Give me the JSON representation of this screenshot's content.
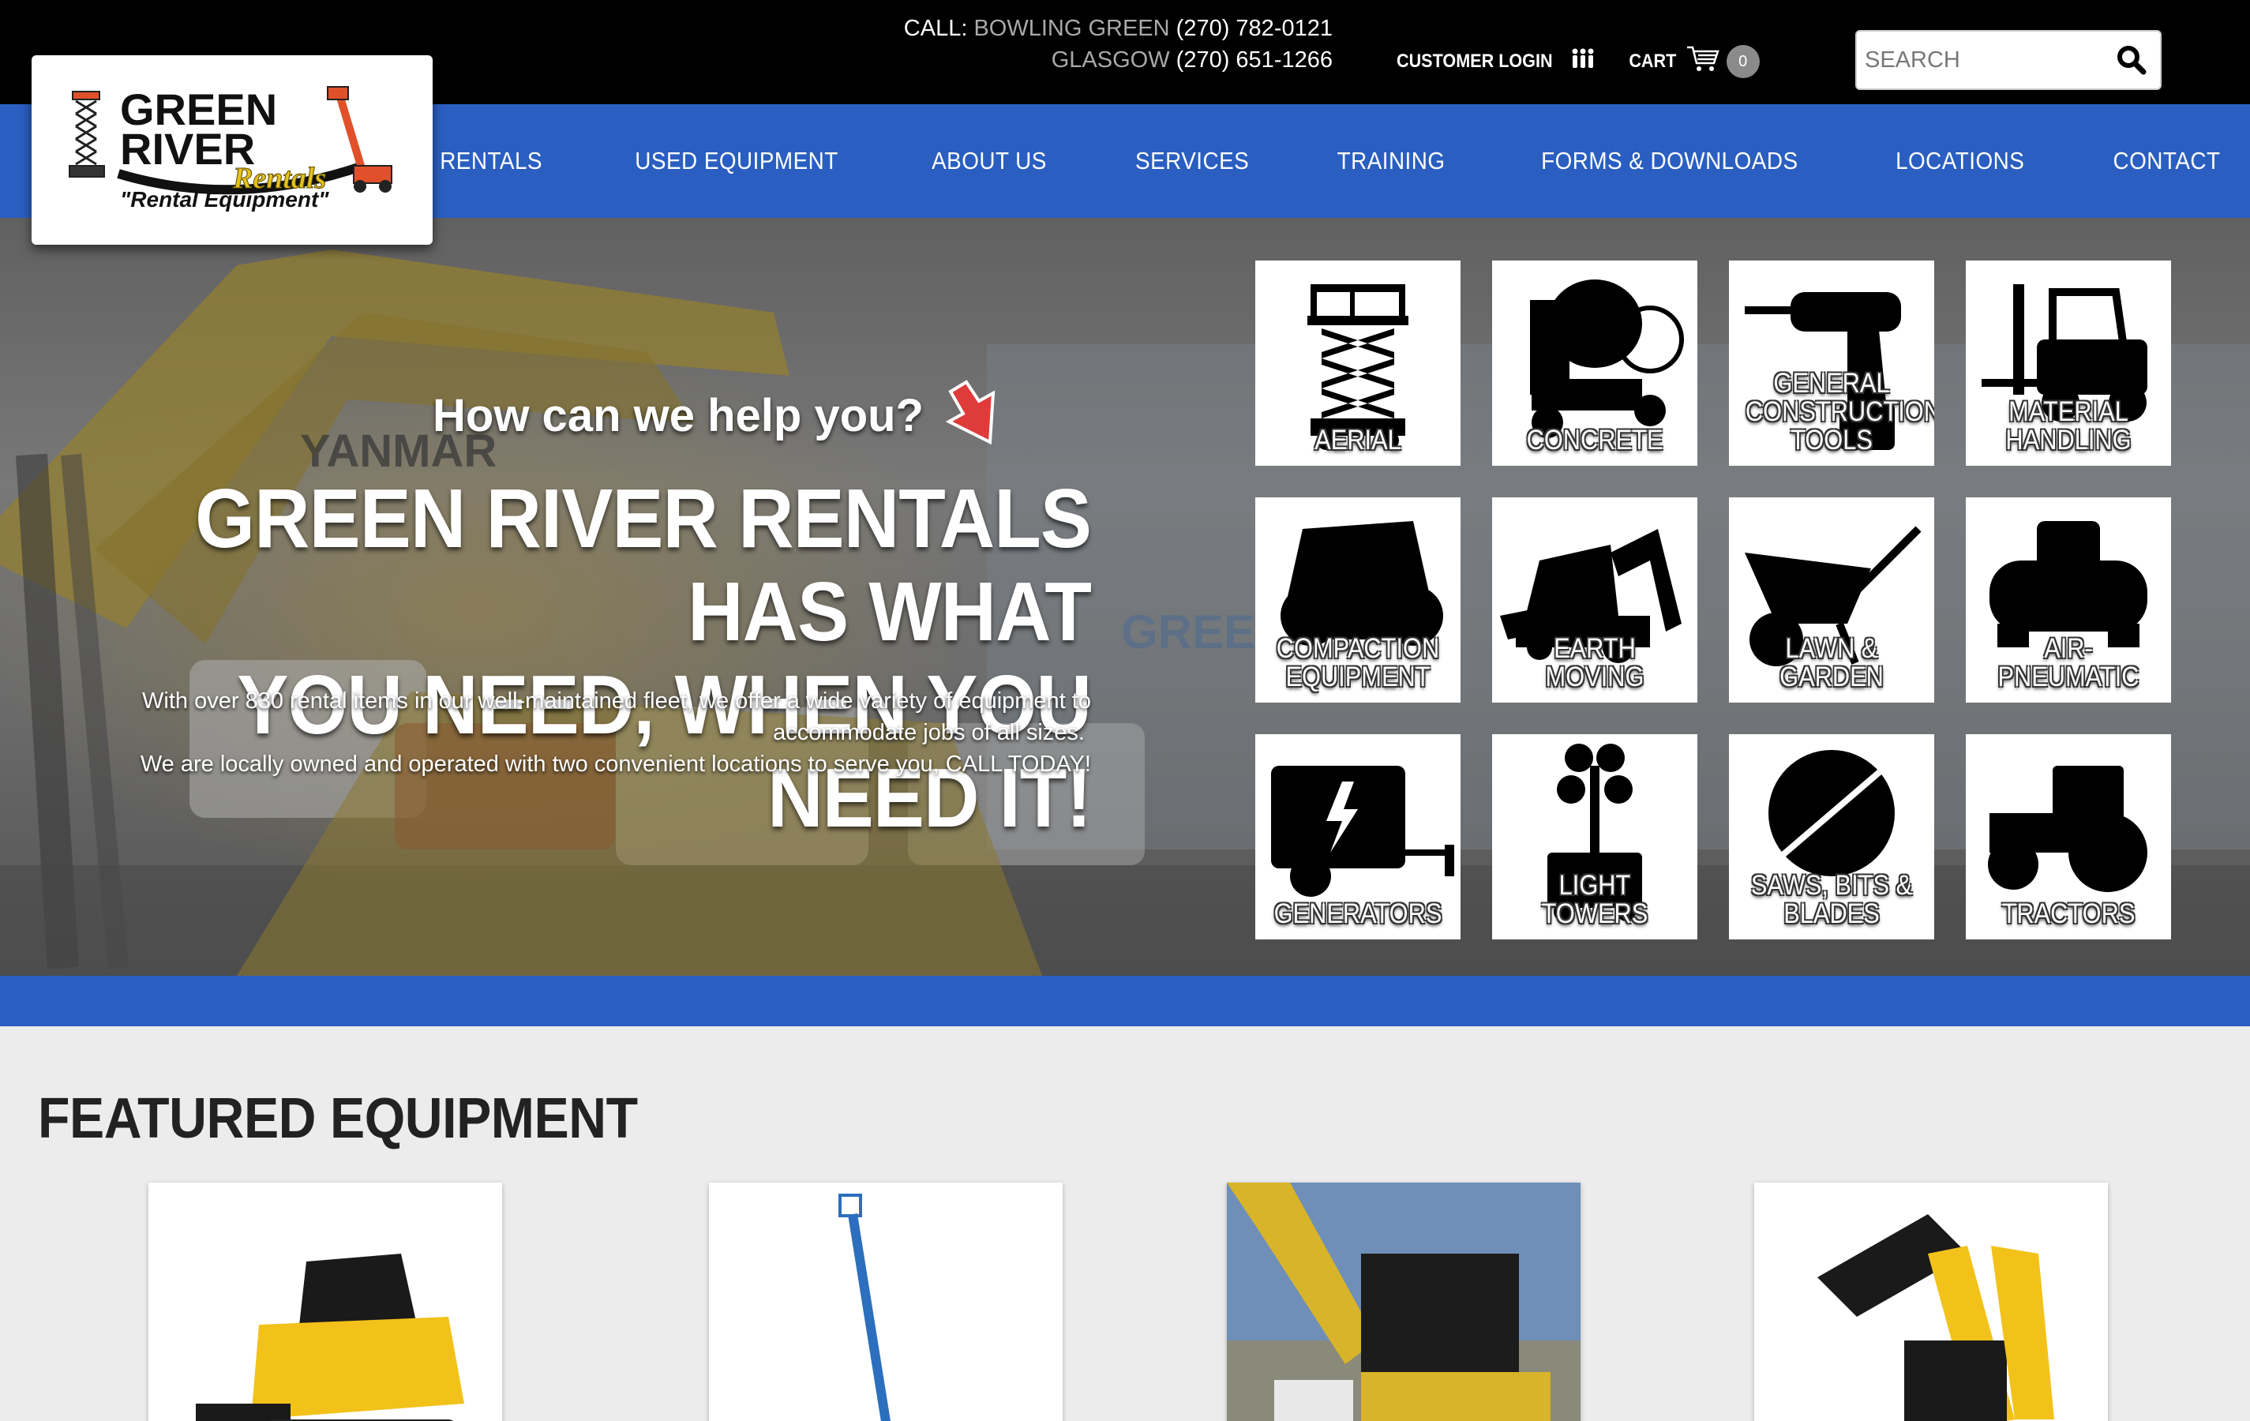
{
  "header": {
    "call_label": "CALL:",
    "phones": [
      {
        "location": "BOWLING GREEN",
        "number": "(270) 782-0121"
      },
      {
        "location": "GLASGOW",
        "number": "(270) 651-1266"
      }
    ],
    "customer_login": "CUSTOMER LOGIN",
    "cart_label": "CART",
    "cart_count": "0",
    "search_placeholder": "SEARCH"
  },
  "logo": {
    "line1": "GREEN",
    "line2": "RIVER",
    "script": "Rentals",
    "tagline": "\"Rental Equipment\""
  },
  "nav": {
    "items": [
      "RENTALS",
      "USED EQUIPMENT",
      "ABOUT US",
      "SERVICES",
      "TRAINING",
      "FORMS & DOWNLOADS",
      "LOCATIONS",
      "CONTACT"
    ]
  },
  "hero": {
    "question": "How can we help you?",
    "headline_line1": "GREEN RIVER RENTALS HAS WHAT",
    "headline_line2": "YOU NEED, WHEN YOU NEED IT!",
    "desc_line1": "With over 830 rental items in our well-maintained fleet, we offer a wide variety of equipment to",
    "desc_line2": "accommodate jobs of all sizes.",
    "desc_line3": "We are locally owned and operated with two convenient locations to serve you, CALL TODAY!",
    "categories": [
      {
        "label": "AERIAL",
        "icon": "scissor-lift-icon"
      },
      {
        "label": "CONCRETE",
        "icon": "concrete-mixer-icon"
      },
      {
        "label": "GENERAL CONSTRUCTION TOOLS",
        "icon": "drill-icon"
      },
      {
        "label": "MATERIAL HANDLING",
        "icon": "forklift-icon"
      },
      {
        "label": "COMPACTION EQUIPMENT",
        "icon": "roller-icon"
      },
      {
        "label": "EARTH MOVING",
        "icon": "backhoe-icon"
      },
      {
        "label": "LAWN & GARDEN",
        "icon": "wheelbarrow-icon"
      },
      {
        "label": "AIR-PNEUMATIC",
        "icon": "compressor-icon"
      },
      {
        "label": "GENERATORS",
        "icon": "generator-icon"
      },
      {
        "label": "LIGHT TOWERS",
        "icon": "light-tower-icon"
      },
      {
        "label": "SAWS, BITS & BLADES",
        "icon": "saw-blade-icon"
      },
      {
        "label": "TRACTORS",
        "icon": "tractor-icon"
      }
    ]
  },
  "featured": {
    "title": "FEATURED EQUIPMENT",
    "items": [
      {
        "image": "track-loader-photo"
      },
      {
        "image": "boom-lift-photo"
      },
      {
        "image": "mini-excavator-photo"
      },
      {
        "image": "skid-steer-photo"
      }
    ]
  },
  "colors": {
    "brand_blue": "#2a5fc1",
    "top_bar": "#000000",
    "logo_green": "#1c1c1c"
  }
}
